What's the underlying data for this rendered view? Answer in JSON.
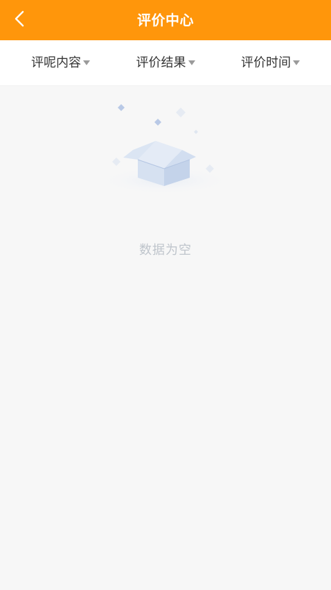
{
  "header": {
    "title": "评价中心"
  },
  "filters": {
    "items": [
      {
        "label": "评呢内容"
      },
      {
        "label": "评价结果"
      },
      {
        "label": "评价时间"
      }
    ]
  },
  "empty_state": {
    "message": "数据为空"
  },
  "colors": {
    "header_bg": "#ff960b",
    "page_bg": "#f7f7f7",
    "illustration": "#c9d7ec"
  }
}
